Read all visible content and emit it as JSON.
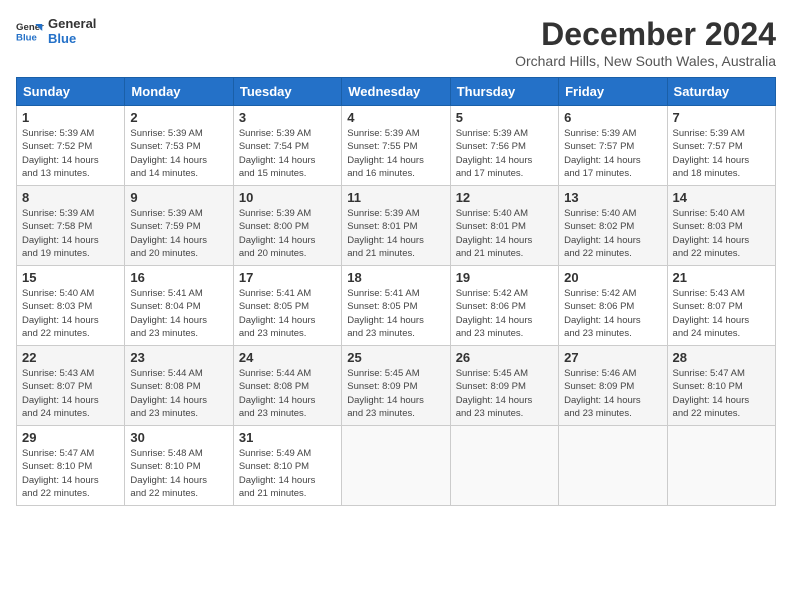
{
  "logo": {
    "line1": "General",
    "line2": "Blue"
  },
  "title": "December 2024",
  "location": "Orchard Hills, New South Wales, Australia",
  "days_of_week": [
    "Sunday",
    "Monday",
    "Tuesday",
    "Wednesday",
    "Thursday",
    "Friday",
    "Saturday"
  ],
  "weeks": [
    [
      {
        "day": "1",
        "info": "Sunrise: 5:39 AM\nSunset: 7:52 PM\nDaylight: 14 hours\nand 13 minutes."
      },
      {
        "day": "2",
        "info": "Sunrise: 5:39 AM\nSunset: 7:53 PM\nDaylight: 14 hours\nand 14 minutes."
      },
      {
        "day": "3",
        "info": "Sunrise: 5:39 AM\nSunset: 7:54 PM\nDaylight: 14 hours\nand 15 minutes."
      },
      {
        "day": "4",
        "info": "Sunrise: 5:39 AM\nSunset: 7:55 PM\nDaylight: 14 hours\nand 16 minutes."
      },
      {
        "day": "5",
        "info": "Sunrise: 5:39 AM\nSunset: 7:56 PM\nDaylight: 14 hours\nand 17 minutes."
      },
      {
        "day": "6",
        "info": "Sunrise: 5:39 AM\nSunset: 7:57 PM\nDaylight: 14 hours\nand 17 minutes."
      },
      {
        "day": "7",
        "info": "Sunrise: 5:39 AM\nSunset: 7:57 PM\nDaylight: 14 hours\nand 18 minutes."
      }
    ],
    [
      {
        "day": "8",
        "info": "Sunrise: 5:39 AM\nSunset: 7:58 PM\nDaylight: 14 hours\nand 19 minutes."
      },
      {
        "day": "9",
        "info": "Sunrise: 5:39 AM\nSunset: 7:59 PM\nDaylight: 14 hours\nand 20 minutes."
      },
      {
        "day": "10",
        "info": "Sunrise: 5:39 AM\nSunset: 8:00 PM\nDaylight: 14 hours\nand 20 minutes."
      },
      {
        "day": "11",
        "info": "Sunrise: 5:39 AM\nSunset: 8:01 PM\nDaylight: 14 hours\nand 21 minutes."
      },
      {
        "day": "12",
        "info": "Sunrise: 5:40 AM\nSunset: 8:01 PM\nDaylight: 14 hours\nand 21 minutes."
      },
      {
        "day": "13",
        "info": "Sunrise: 5:40 AM\nSunset: 8:02 PM\nDaylight: 14 hours\nand 22 minutes."
      },
      {
        "day": "14",
        "info": "Sunrise: 5:40 AM\nSunset: 8:03 PM\nDaylight: 14 hours\nand 22 minutes."
      }
    ],
    [
      {
        "day": "15",
        "info": "Sunrise: 5:40 AM\nSunset: 8:03 PM\nDaylight: 14 hours\nand 22 minutes."
      },
      {
        "day": "16",
        "info": "Sunrise: 5:41 AM\nSunset: 8:04 PM\nDaylight: 14 hours\nand 23 minutes."
      },
      {
        "day": "17",
        "info": "Sunrise: 5:41 AM\nSunset: 8:05 PM\nDaylight: 14 hours\nand 23 minutes."
      },
      {
        "day": "18",
        "info": "Sunrise: 5:41 AM\nSunset: 8:05 PM\nDaylight: 14 hours\nand 23 minutes."
      },
      {
        "day": "19",
        "info": "Sunrise: 5:42 AM\nSunset: 8:06 PM\nDaylight: 14 hours\nand 23 minutes."
      },
      {
        "day": "20",
        "info": "Sunrise: 5:42 AM\nSunset: 8:06 PM\nDaylight: 14 hours\nand 23 minutes."
      },
      {
        "day": "21",
        "info": "Sunrise: 5:43 AM\nSunset: 8:07 PM\nDaylight: 14 hours\nand 24 minutes."
      }
    ],
    [
      {
        "day": "22",
        "info": "Sunrise: 5:43 AM\nSunset: 8:07 PM\nDaylight: 14 hours\nand 24 minutes."
      },
      {
        "day": "23",
        "info": "Sunrise: 5:44 AM\nSunset: 8:08 PM\nDaylight: 14 hours\nand 23 minutes."
      },
      {
        "day": "24",
        "info": "Sunrise: 5:44 AM\nSunset: 8:08 PM\nDaylight: 14 hours\nand 23 minutes."
      },
      {
        "day": "25",
        "info": "Sunrise: 5:45 AM\nSunset: 8:09 PM\nDaylight: 14 hours\nand 23 minutes."
      },
      {
        "day": "26",
        "info": "Sunrise: 5:45 AM\nSunset: 8:09 PM\nDaylight: 14 hours\nand 23 minutes."
      },
      {
        "day": "27",
        "info": "Sunrise: 5:46 AM\nSunset: 8:09 PM\nDaylight: 14 hours\nand 23 minutes."
      },
      {
        "day": "28",
        "info": "Sunrise: 5:47 AM\nSunset: 8:10 PM\nDaylight: 14 hours\nand 22 minutes."
      }
    ],
    [
      {
        "day": "29",
        "info": "Sunrise: 5:47 AM\nSunset: 8:10 PM\nDaylight: 14 hours\nand 22 minutes."
      },
      {
        "day": "30",
        "info": "Sunrise: 5:48 AM\nSunset: 8:10 PM\nDaylight: 14 hours\nand 22 minutes."
      },
      {
        "day": "31",
        "info": "Sunrise: 5:49 AM\nSunset: 8:10 PM\nDaylight: 14 hours\nand 21 minutes."
      },
      {
        "day": "",
        "info": ""
      },
      {
        "day": "",
        "info": ""
      },
      {
        "day": "",
        "info": ""
      },
      {
        "day": "",
        "info": ""
      }
    ]
  ]
}
